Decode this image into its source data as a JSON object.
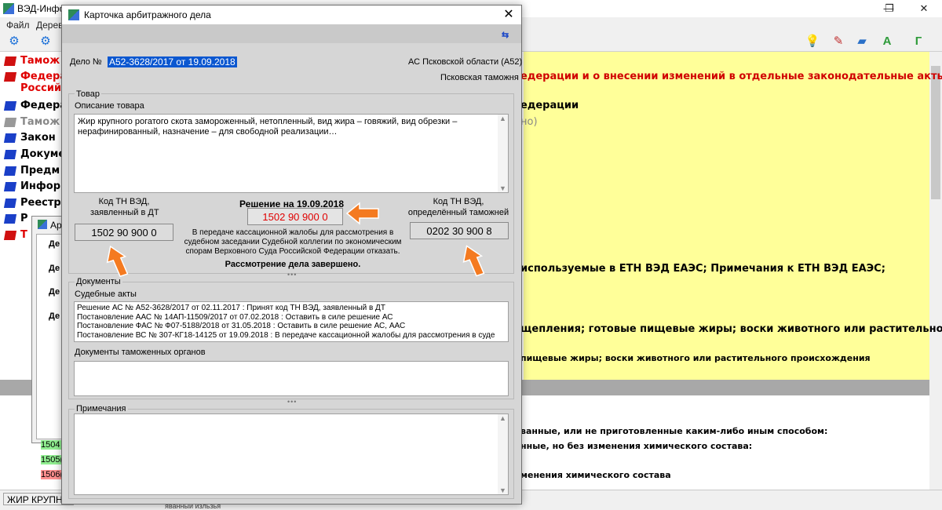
{
  "main_window": {
    "title": "ВЭД-Инфо",
    "controls": {
      "minimize": "—",
      "maximize": "❐",
      "close": "✕"
    },
    "menu": [
      "Файл",
      "Дерев"
    ],
    "tree_items": [
      {
        "label": "Тамож",
        "color": "#e00000"
      },
      {
        "label": "Федера",
        "color": "#e00000"
      },
      {
        "label": "Россий",
        "color": "#e00000"
      },
      {
        "label": "Федера",
        "color": "#000000"
      },
      {
        "label": "Тамож",
        "color": "#888888"
      },
      {
        "label": "Закон",
        "color": "#000000"
      },
      {
        "label": "Докуме",
        "color": "#000000"
      },
      {
        "label": "Предм",
        "color": "#000000"
      },
      {
        "label": "Инфор",
        "color": "#000000"
      },
      {
        "label": "Реестр",
        "color": "#000000"
      },
      {
        "label": "Р",
        "color": "#000000"
      },
      {
        "label": "Т",
        "color": "#e00000"
      }
    ],
    "subtree": [
      "Де",
      "Де",
      "Де",
      "Де"
    ],
    "bg_dialog_title": "Ар",
    "list_codes": [
      "1504",
      "1505(",
      "1506("
    ],
    "right_lines": [
      "едерации и о внесении изменений в отдельные законодательные акты",
      "едерации",
      "но)",
      "используемые в ЕТН ВЭД ЕАЭС; Примечания к ЕТН ВЭД ЕАЭС;",
      "щепления; готовые пищевые жиры; воски животного или растительного",
      "пищевые жиры; воски животного или растительного происхождения",
      "ванные, или не приготовленные каким-либо иным способом:",
      "нные, но без изменения химического состава:",
      "менения химического состава"
    ],
    "status_text": "ЖИР КРУПНО",
    "status_text2": "яванный изльзья"
  },
  "dialog": {
    "title": "Карточка арбитражного дела",
    "case_label": "Дело №",
    "case_number": "А52-3628/2017 от 19.09.2018",
    "court": "АС Псковской области (А52)",
    "customs": "Псковская таможня",
    "goods_group": "Товар",
    "goods_desc_label": "Описание товара",
    "goods_desc": "Жир крупного рогатого скота замороженный, нетопленный, вид жира – говяжий, вид обрезки – нерафинированный, назначение – для свободной реализации…",
    "declared_label_1": "Код ТН ВЭД,",
    "declared_label_2": "заявленный в ДТ",
    "declared_code": "1502 90 900 0",
    "decision_label": "Решение на 19.09.2018",
    "decision_code": "1502 90 900 0",
    "decision_text_1": "В передаче кассационной жалобы для рассмотрения в",
    "decision_text_2": "судебном заседании Судебной коллегии по экономическим",
    "decision_text_3": "спорам Верховного Суда Российской Федерации отказать.",
    "decision_status": "Рассмотрение дела завершено.",
    "customs_label_1": "Код ТН ВЭД,",
    "customs_label_2": "определённый таможней",
    "customs_code": "0202 30 900 8",
    "documents_group": "Документы",
    "court_acts_label": "Судебные акты",
    "court_acts": [
      "Решение АС № А52-3628/2017 от 02.11.2017 : Принят код ТН ВЭД, заявленный в ДТ",
      "Постановление ААС № 14АП-11509/2017 от 07.02.2018 : Оставить в силе решение АС",
      "Постановление ФАС № Ф07-5188/2018 от 31.05.2018 : Оставить в силе решение АС, ААС",
      "Постановление ВС № 307-КГ18-14125 от 19.09.2018 : В передаче кассационной жалобы для рассмотрения в суде"
    ],
    "customs_docs_label": "Документы таможенных органов",
    "notes_label": "Примечания",
    "splitter": "•••",
    "nav_icon": "⇆"
  },
  "colors": {
    "accent_selection": "#0b57d0",
    "decision_code": "#e00000",
    "annotation_arrow": "#f47a20",
    "right_pane_bg": "#ffff99"
  }
}
